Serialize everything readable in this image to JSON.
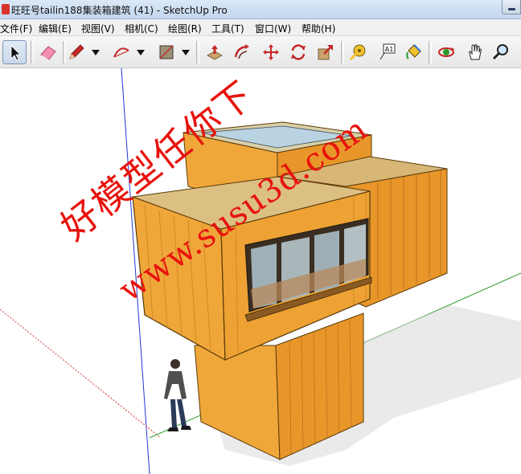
{
  "window": {
    "title": "旺旺号tailin188集装箱建筑 (41) - SketchUp Pro"
  },
  "menu": {
    "items": [
      {
        "label": "文件(F)"
      },
      {
        "label": "编辑(E)"
      },
      {
        "label": "视图(V)"
      },
      {
        "label": "相机(C)"
      },
      {
        "label": "绘图(R)"
      },
      {
        "label": "工具(T)"
      },
      {
        "label": "窗口(W)"
      },
      {
        "label": "帮助(H)"
      }
    ]
  },
  "toolbar": {
    "tools": [
      {
        "icon": "select-arrow-icon",
        "active": true
      },
      {
        "icon": "eraser-icon"
      },
      {
        "icon": "pencil-line-icon"
      },
      {
        "icon": "arc-icon"
      },
      {
        "icon": "rectangle-icon"
      },
      {
        "icon": "push-pull-icon"
      },
      {
        "icon": "offset-icon"
      },
      {
        "icon": "move-icon"
      },
      {
        "icon": "rotate-icon"
      },
      {
        "icon": "scale-icon"
      },
      {
        "icon": "tape-measure-icon"
      },
      {
        "icon": "text-label-icon"
      },
      {
        "icon": "paint-bucket-icon"
      },
      {
        "icon": "orbit-icon"
      },
      {
        "icon": "pan-hand-icon"
      },
      {
        "icon": "zoom-magnifier-icon"
      }
    ],
    "text_label_glyph": "A1"
  },
  "viewport": {
    "watermark_line1": "好模型任你下",
    "watermark_line2": "www.susu3d.com"
  },
  "colors": {
    "container_face": "#f0a73a",
    "container_side": "#e8962a",
    "container_shade": "#d9861e",
    "watermark": "#e8120c",
    "axis_red": "#d33",
    "axis_green": "#2c9b2c",
    "axis_blue": "#2438d6"
  }
}
